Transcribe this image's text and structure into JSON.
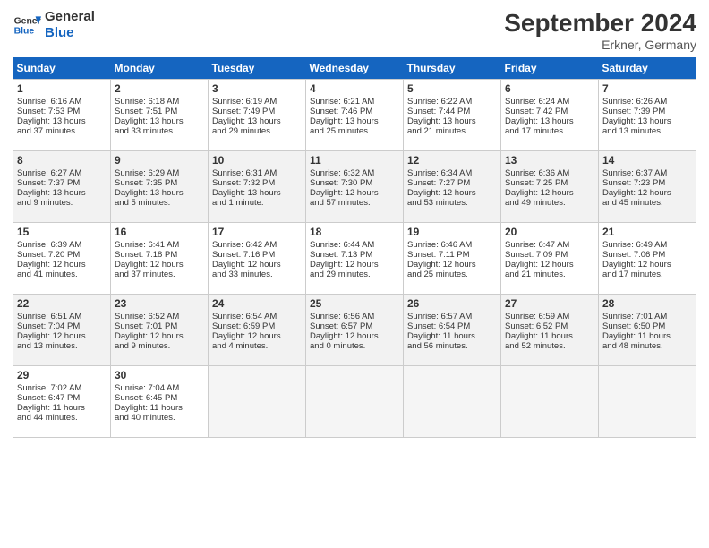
{
  "header": {
    "logo_line1": "General",
    "logo_line2": "Blue",
    "month_title": "September 2024",
    "subtitle": "Erkner, Germany"
  },
  "columns": [
    "Sunday",
    "Monday",
    "Tuesday",
    "Wednesday",
    "Thursday",
    "Friday",
    "Saturday"
  ],
  "weeks": [
    [
      {
        "day": "1",
        "lines": [
          "Sunrise: 6:16 AM",
          "Sunset: 7:53 PM",
          "Daylight: 13 hours",
          "and 37 minutes."
        ]
      },
      {
        "day": "2",
        "lines": [
          "Sunrise: 6:18 AM",
          "Sunset: 7:51 PM",
          "Daylight: 13 hours",
          "and 33 minutes."
        ]
      },
      {
        "day": "3",
        "lines": [
          "Sunrise: 6:19 AM",
          "Sunset: 7:49 PM",
          "Daylight: 13 hours",
          "and 29 minutes."
        ]
      },
      {
        "day": "4",
        "lines": [
          "Sunrise: 6:21 AM",
          "Sunset: 7:46 PM",
          "Daylight: 13 hours",
          "and 25 minutes."
        ]
      },
      {
        "day": "5",
        "lines": [
          "Sunrise: 6:22 AM",
          "Sunset: 7:44 PM",
          "Daylight: 13 hours",
          "and 21 minutes."
        ]
      },
      {
        "day": "6",
        "lines": [
          "Sunrise: 6:24 AM",
          "Sunset: 7:42 PM",
          "Daylight: 13 hours",
          "and 17 minutes."
        ]
      },
      {
        "day": "7",
        "lines": [
          "Sunrise: 6:26 AM",
          "Sunset: 7:39 PM",
          "Daylight: 13 hours",
          "and 13 minutes."
        ]
      }
    ],
    [
      {
        "day": "8",
        "lines": [
          "Sunrise: 6:27 AM",
          "Sunset: 7:37 PM",
          "Daylight: 13 hours",
          "and 9 minutes."
        ]
      },
      {
        "day": "9",
        "lines": [
          "Sunrise: 6:29 AM",
          "Sunset: 7:35 PM",
          "Daylight: 13 hours",
          "and 5 minutes."
        ]
      },
      {
        "day": "10",
        "lines": [
          "Sunrise: 6:31 AM",
          "Sunset: 7:32 PM",
          "Daylight: 13 hours",
          "and 1 minute."
        ]
      },
      {
        "day": "11",
        "lines": [
          "Sunrise: 6:32 AM",
          "Sunset: 7:30 PM",
          "Daylight: 12 hours",
          "and 57 minutes."
        ]
      },
      {
        "day": "12",
        "lines": [
          "Sunrise: 6:34 AM",
          "Sunset: 7:27 PM",
          "Daylight: 12 hours",
          "and 53 minutes."
        ]
      },
      {
        "day": "13",
        "lines": [
          "Sunrise: 6:36 AM",
          "Sunset: 7:25 PM",
          "Daylight: 12 hours",
          "and 49 minutes."
        ]
      },
      {
        "day": "14",
        "lines": [
          "Sunrise: 6:37 AM",
          "Sunset: 7:23 PM",
          "Daylight: 12 hours",
          "and 45 minutes."
        ]
      }
    ],
    [
      {
        "day": "15",
        "lines": [
          "Sunrise: 6:39 AM",
          "Sunset: 7:20 PM",
          "Daylight: 12 hours",
          "and 41 minutes."
        ]
      },
      {
        "day": "16",
        "lines": [
          "Sunrise: 6:41 AM",
          "Sunset: 7:18 PM",
          "Daylight: 12 hours",
          "and 37 minutes."
        ]
      },
      {
        "day": "17",
        "lines": [
          "Sunrise: 6:42 AM",
          "Sunset: 7:16 PM",
          "Daylight: 12 hours",
          "and 33 minutes."
        ]
      },
      {
        "day": "18",
        "lines": [
          "Sunrise: 6:44 AM",
          "Sunset: 7:13 PM",
          "Daylight: 12 hours",
          "and 29 minutes."
        ]
      },
      {
        "day": "19",
        "lines": [
          "Sunrise: 6:46 AM",
          "Sunset: 7:11 PM",
          "Daylight: 12 hours",
          "and 25 minutes."
        ]
      },
      {
        "day": "20",
        "lines": [
          "Sunrise: 6:47 AM",
          "Sunset: 7:09 PM",
          "Daylight: 12 hours",
          "and 21 minutes."
        ]
      },
      {
        "day": "21",
        "lines": [
          "Sunrise: 6:49 AM",
          "Sunset: 7:06 PM",
          "Daylight: 12 hours",
          "and 17 minutes."
        ]
      }
    ],
    [
      {
        "day": "22",
        "lines": [
          "Sunrise: 6:51 AM",
          "Sunset: 7:04 PM",
          "Daylight: 12 hours",
          "and 13 minutes."
        ]
      },
      {
        "day": "23",
        "lines": [
          "Sunrise: 6:52 AM",
          "Sunset: 7:01 PM",
          "Daylight: 12 hours",
          "and 9 minutes."
        ]
      },
      {
        "day": "24",
        "lines": [
          "Sunrise: 6:54 AM",
          "Sunset: 6:59 PM",
          "Daylight: 12 hours",
          "and 4 minutes."
        ]
      },
      {
        "day": "25",
        "lines": [
          "Sunrise: 6:56 AM",
          "Sunset: 6:57 PM",
          "Daylight: 12 hours",
          "and 0 minutes."
        ]
      },
      {
        "day": "26",
        "lines": [
          "Sunrise: 6:57 AM",
          "Sunset: 6:54 PM",
          "Daylight: 11 hours",
          "and 56 minutes."
        ]
      },
      {
        "day": "27",
        "lines": [
          "Sunrise: 6:59 AM",
          "Sunset: 6:52 PM",
          "Daylight: 11 hours",
          "and 52 minutes."
        ]
      },
      {
        "day": "28",
        "lines": [
          "Sunrise: 7:01 AM",
          "Sunset: 6:50 PM",
          "Daylight: 11 hours",
          "and 48 minutes."
        ]
      }
    ],
    [
      {
        "day": "29",
        "lines": [
          "Sunrise: 7:02 AM",
          "Sunset: 6:47 PM",
          "Daylight: 11 hours",
          "and 44 minutes."
        ]
      },
      {
        "day": "30",
        "lines": [
          "Sunrise: 7:04 AM",
          "Sunset: 6:45 PM",
          "Daylight: 11 hours",
          "and 40 minutes."
        ]
      },
      {
        "day": "",
        "lines": []
      },
      {
        "day": "",
        "lines": []
      },
      {
        "day": "",
        "lines": []
      },
      {
        "day": "",
        "lines": []
      },
      {
        "day": "",
        "lines": []
      }
    ]
  ]
}
